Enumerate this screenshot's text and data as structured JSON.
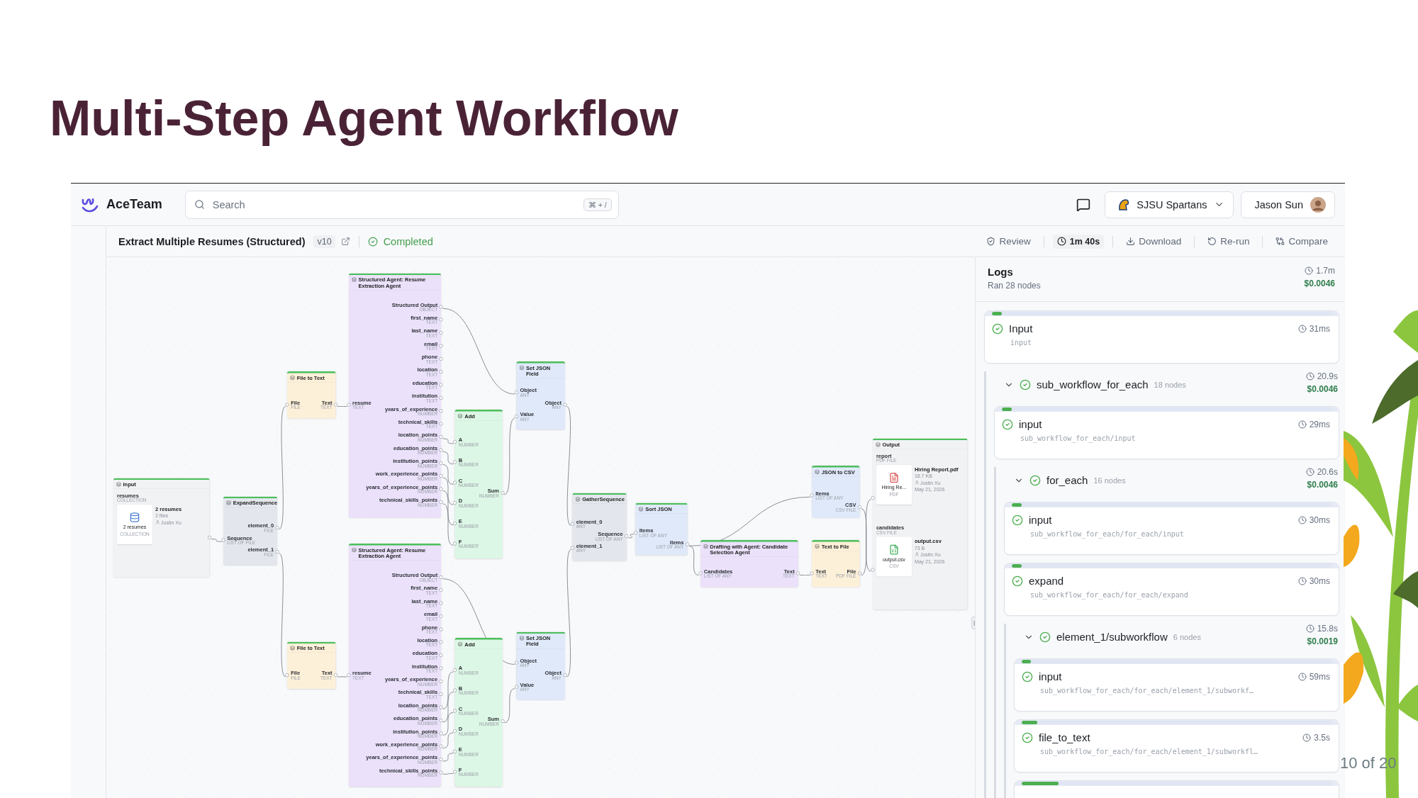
{
  "slide": {
    "title": "Multi-Step Agent Workflow",
    "page_number": "10 of 20"
  },
  "app": {
    "brand": "AceTeam",
    "search": {
      "placeholder": "Search",
      "shortcut": "⌘ + /"
    },
    "team": "SJSU Spartans",
    "user": "Jason Sun"
  },
  "workflow": {
    "title": "Extract Multiple Resumes (Structured)",
    "version": "v10",
    "status": "Completed",
    "actions": [
      {
        "kind": "review",
        "label": "Review"
      },
      {
        "kind": "duration",
        "label": "1m 40s"
      },
      {
        "kind": "download",
        "label": "Download"
      },
      {
        "kind": "rerun",
        "label": "Re-run"
      },
      {
        "kind": "compare",
        "label": "Compare"
      }
    ]
  },
  "canvas": {
    "nodes": [
      {
        "kind": "input",
        "title": "Input",
        "color": "#f1f2f4",
        "fields": [
          {
            "name": "resumes",
            "type": "COLLECTION",
            "kind": "collection",
            "card_title": "2 resumes",
            "card_type": "COLLECTION",
            "lines": [
              {
                "kind": "title",
                "text": "2 resumes"
              },
              {
                "kind": "plain",
                "text": "2 files"
              },
              {
                "kind": "owner",
                "text": "Justin Xu"
              }
            ]
          }
        ]
      },
      {
        "kind": "basic",
        "title": "ExpandSequence",
        "color": "#e3e7ed",
        "inputs": [
          {
            "name": "Sequence",
            "type": "LIST OF FILE"
          }
        ],
        "outputs": [
          {
            "name": "element_0",
            "type": "FILE"
          },
          {
            "name": "element_1",
            "type": "FILE"
          }
        ]
      },
      {
        "kind": "basic",
        "title": "File to Text",
        "color": "#fdf0d9",
        "inputs": [
          {
            "name": "File",
            "type": "FILE"
          }
        ],
        "outputs": [
          {
            "name": "Text",
            "type": "TEXT"
          }
        ]
      },
      {
        "kind": "basic",
        "title": "File to Text",
        "color": "#fdf0d9",
        "inputs": [
          {
            "name": "File",
            "type": "FILE"
          }
        ],
        "outputs": [
          {
            "name": "Text",
            "type": "TEXT"
          }
        ]
      },
      {
        "kind": "basic",
        "title": "Structured Agent: Resume Extraction Agent",
        "color": "#ebe1fb",
        "inputs": [
          {
            "name": "resume",
            "type": "TEXT"
          }
        ],
        "outputs": [
          {
            "name": "Structured Output",
            "type": "OBJECT"
          },
          {
            "name": "first_name",
            "type": "TEXT"
          },
          {
            "name": "last_name",
            "type": "TEXT"
          },
          {
            "name": "email",
            "type": "TEXT"
          },
          {
            "name": "phone",
            "type": "TEXT"
          },
          {
            "name": "location",
            "type": "TEXT"
          },
          {
            "name": "education",
            "type": "TEXT"
          },
          {
            "name": "institution",
            "type": "TEXT"
          },
          {
            "name": "years_of_experience",
            "type": "NUMBER"
          },
          {
            "name": "technical_skills",
            "type": "TEXT"
          },
          {
            "name": "location_points",
            "type": "NUMBER"
          },
          {
            "name": "education_points",
            "type": "NUMBER"
          },
          {
            "name": "institution_points",
            "type": "NUMBER"
          },
          {
            "name": "work_experience_points",
            "type": "NUMBER"
          },
          {
            "name": "years_of_experience_points",
            "type": "NUMBER"
          },
          {
            "name": "technical_skills_points",
            "type": "NUMBER"
          }
        ]
      },
      {
        "kind": "basic",
        "title": "Structured Agent: Resume Extraction Agent",
        "color": "#ebe1fb",
        "inputs": [
          {
            "name": "resume",
            "type": "TEXT"
          }
        ],
        "outputs": [
          {
            "name": "Structured Output",
            "type": "OBJECT"
          },
          {
            "name": "first_name",
            "type": "TEXT"
          },
          {
            "name": "last_name",
            "type": "TEXT"
          },
          {
            "name": "email",
            "type": "TEXT"
          },
          {
            "name": "phone",
            "type": "TEXT"
          },
          {
            "name": "location",
            "type": "TEXT"
          },
          {
            "name": "education",
            "type": "TEXT"
          },
          {
            "name": "institution",
            "type": "TEXT"
          },
          {
            "name": "years_of_experience",
            "type": "NUMBER"
          },
          {
            "name": "technical_skills",
            "type": "TEXT"
          },
          {
            "name": "location_points",
            "type": "NUMBER"
          },
          {
            "name": "education_points",
            "type": "NUMBER"
          },
          {
            "name": "institution_points",
            "type": "NUMBER"
          },
          {
            "name": "work_experience_points",
            "type": "NUMBER"
          },
          {
            "name": "years_of_experience_points",
            "type": "NUMBER"
          },
          {
            "name": "technical_skills_points",
            "type": "NUMBER"
          }
        ]
      },
      {
        "kind": "basic",
        "title": "Add",
        "color": "#ddf7e6",
        "inputs": [
          {
            "name": "A",
            "type": "NUMBER"
          },
          {
            "name": "B",
            "type": "NUMBER"
          },
          {
            "name": "C",
            "type": "NUMBER"
          },
          {
            "name": "D",
            "type": "NUMBER"
          },
          {
            "name": "E",
            "type": "NUMBER"
          },
          {
            "name": "F",
            "type": "NUMBER"
          }
        ],
        "outputs": [
          {
            "name": "Sum",
            "type": "NUMBER"
          }
        ]
      },
      {
        "kind": "basic",
        "title": "Add",
        "color": "#ddf7e6",
        "inputs": [
          {
            "name": "A",
            "type": "NUMBER"
          },
          {
            "name": "B",
            "type": "NUMBER"
          },
          {
            "name": "C",
            "type": "NUMBER"
          },
          {
            "name": "D",
            "type": "NUMBER"
          },
          {
            "name": "E",
            "type": "NUMBER"
          },
          {
            "name": "F",
            "type": "NUMBER"
          }
        ],
        "outputs": [
          {
            "name": "Sum",
            "type": "NUMBER"
          }
        ]
      },
      {
        "kind": "basic",
        "title": "Set JSON Field",
        "color": "#e0e9fa",
        "inputs": [
          {
            "name": "Object",
            "type": "ANY"
          },
          {
            "name": "Value",
            "type": "ANY"
          }
        ],
        "outputs": [
          {
            "name": "Object",
            "type": "ANY"
          }
        ]
      },
      {
        "kind": "basic",
        "title": "Set JSON Field",
        "color": "#e0e9fa",
        "inputs": [
          {
            "name": "Object",
            "type": "ANY"
          },
          {
            "name": "Value",
            "type": "ANY"
          }
        ],
        "outputs": [
          {
            "name": "Object",
            "type": "ANY"
          }
        ]
      },
      {
        "kind": "basic",
        "title": "GatherSequence",
        "color": "#e3e7ed",
        "inputs": [
          {
            "name": "element_0",
            "type": "ANY"
          },
          {
            "name": "element_1",
            "type": "ANY"
          }
        ],
        "outputs": [
          {
            "name": "Sequence",
            "type": "LIST OF ANY"
          }
        ]
      },
      {
        "kind": "basic",
        "title": "Sort JSON",
        "color": "#e0e9fa",
        "inputs": [
          {
            "name": "Items",
            "type": "LIST OF ANY"
          }
        ],
        "outputs": [
          {
            "name": "Items",
            "type": "LIST OF ANY"
          }
        ]
      },
      {
        "kind": "basic",
        "title": "Drafting with Agent: Candidate Selection Agent",
        "color": "#ebe1fb",
        "inputs": [
          {
            "name": "Candidates",
            "type": "LIST OF ANY"
          }
        ],
        "outputs": [
          {
            "name": "Text",
            "type": "TEXT"
          }
        ]
      },
      {
        "kind": "basic",
        "title": "JSON to CSV",
        "color": "#e0e9fa",
        "inputs": [
          {
            "name": "Items",
            "type": "LIST OF ANY"
          }
        ],
        "outputs": [
          {
            "name": "CSV",
            "type": "CSV FILE"
          }
        ]
      },
      {
        "kind": "basic",
        "title": "Text to File",
        "color": "#fdf0d9",
        "inputs": [
          {
            "name": "Text",
            "type": "TEXT"
          }
        ],
        "outputs": [
          {
            "name": "File",
            "type": "PDF FILE"
          }
        ]
      },
      {
        "kind": "output",
        "title": "Output",
        "color": "#f1f2f4",
        "fields": [
          {
            "name": "report",
            "type": "PDF FILE",
            "kind": "pdf",
            "card_title": "Hiring Re...",
            "card_type": "PDF",
            "lines": [
              {
                "kind": "title",
                "text": "Hiring Report.pdf"
              },
              {
                "kind": "plain",
                "text": "18.7 KB"
              },
              {
                "kind": "owner",
                "text": "Justin Xu"
              },
              {
                "kind": "plain",
                "text": "May 21, 2026"
              }
            ]
          },
          {
            "name": "candidates",
            "type": "CSV FILE",
            "kind": "csv",
            "card_title": "output.csv",
            "card_type": "CSV",
            "lines": [
              {
                "kind": "title",
                "text": "output.csv"
              },
              {
                "kind": "plain",
                "text": "73 B"
              },
              {
                "kind": "owner",
                "text": "Justin Xu"
              },
              {
                "kind": "plain",
                "text": "May 21, 2026"
              }
            ]
          }
        ]
      }
    ]
  },
  "logs": {
    "title": "Logs",
    "summary": "Ran 28 nodes",
    "duration": "1.7m",
    "cost": "$0.0046",
    "items": [
      {
        "kind": "step",
        "name": "Input",
        "path": "input",
        "time": "31ms",
        "level": 0.03
      },
      {
        "kind": "group",
        "name": "sub_workflow_for_each",
        "count": "18 nodes",
        "time": "20.9s",
        "cost": "$0.0046",
        "expanded": true,
        "children": [
          {
            "kind": "step",
            "name": "input",
            "path": "sub_workflow_for_each/input",
            "time": "29ms",
            "level": 0.03
          },
          {
            "kind": "group",
            "name": "for_each",
            "count": "16 nodes",
            "time": "20.6s",
            "cost": "$0.0046",
            "expanded": true,
            "children": [
              {
                "kind": "step",
                "name": "input",
                "path": "sub_workflow_for_each/for_each/input",
                "time": "30ms",
                "level": 0.03
              },
              {
                "kind": "step",
                "name": "expand",
                "path": "sub_workflow_for_each/for_each/expand",
                "time": "30ms",
                "level": 0.03
              },
              {
                "kind": "group",
                "name": "element_1/subworkflow",
                "count": "6 nodes",
                "time": "15.8s",
                "cost": "$0.0019",
                "expanded": true,
                "children": [
                  {
                    "kind": "step",
                    "name": "input",
                    "path": "sub_workflow_for_each/for_each/element_1/subworkf…",
                    "time": "59ms",
                    "level": 0.03
                  },
                  {
                    "kind": "step",
                    "name": "file_to_text",
                    "path": "sub_workflow_for_each/for_each/element_1/subworkfl…",
                    "time": "3.5s",
                    "level": 0.05
                  },
                  {
                    "kind": "step",
                    "level": 0.12
                  }
                ]
              }
            ]
          }
        ]
      }
    ]
  }
}
